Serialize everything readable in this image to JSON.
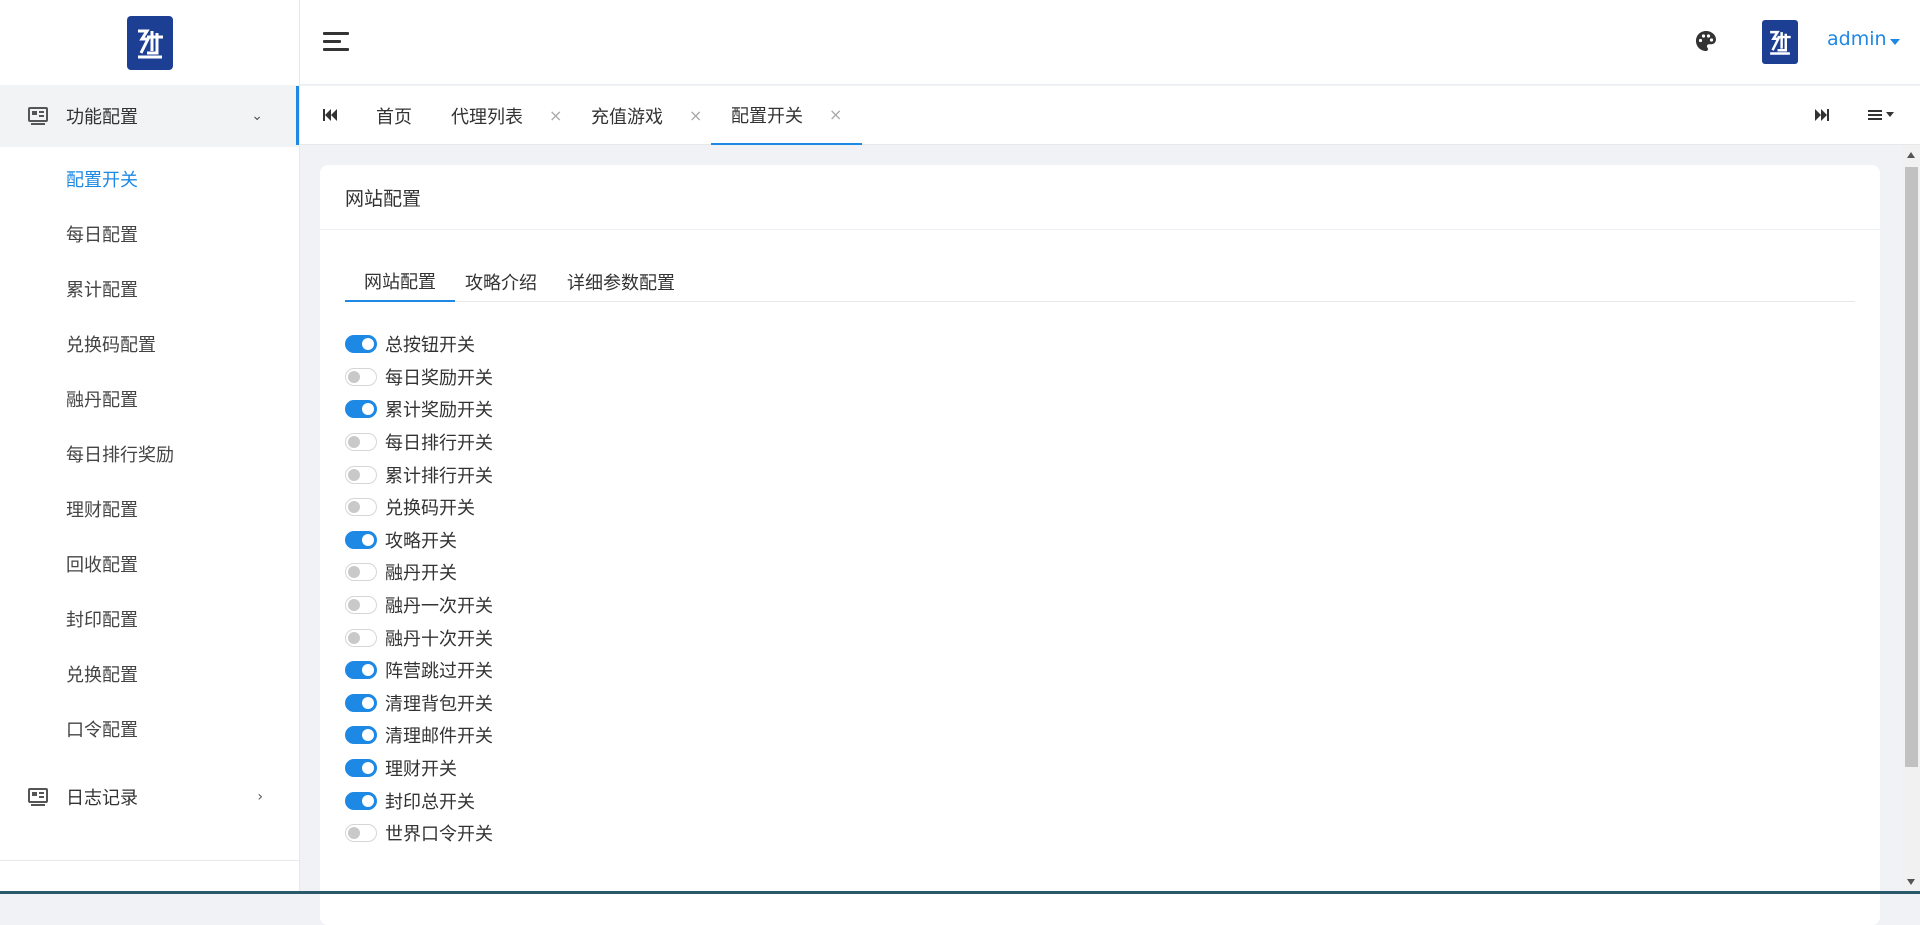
{
  "sidebar": {
    "groups": [
      {
        "label": "功能配置",
        "arrow": "⌄"
      },
      {
        "label": "日志记录",
        "arrow": "›"
      }
    ],
    "items": [
      {
        "label": "配置开关"
      },
      {
        "label": "每日配置"
      },
      {
        "label": "累计配置"
      },
      {
        "label": "兑换码配置"
      },
      {
        "label": "融丹配置"
      },
      {
        "label": "每日排行奖励"
      },
      {
        "label": "理财配置"
      },
      {
        "label": "回收配置"
      },
      {
        "label": "封印配置"
      },
      {
        "label": "兑换配置"
      },
      {
        "label": "口令配置"
      }
    ]
  },
  "header": {
    "user_name": "admin"
  },
  "tabs": [
    {
      "label": "首页",
      "close": ""
    },
    {
      "label": "代理列表",
      "close": "×"
    },
    {
      "label": "充值游戏",
      "close": "×"
    },
    {
      "label": "配置开关",
      "close": "×"
    }
  ],
  "card": {
    "title": "网站配置",
    "inner_tabs": [
      {
        "label": "网站配置"
      },
      {
        "label": "攻略介绍"
      },
      {
        "label": "详细参数配置"
      }
    ],
    "switches": [
      {
        "label": "总按钮开关",
        "on": true
      },
      {
        "label": "每日奖励开关",
        "on": false
      },
      {
        "label": "累计奖励开关",
        "on": true
      },
      {
        "label": "每日排行开关",
        "on": false
      },
      {
        "label": "累计排行开关",
        "on": false
      },
      {
        "label": "兑换码开关",
        "on": false
      },
      {
        "label": "攻略开关",
        "on": true
      },
      {
        "label": "融丹开关",
        "on": false
      },
      {
        "label": "融丹一次开关",
        "on": false
      },
      {
        "label": "融丹十次开关",
        "on": false
      },
      {
        "label": "阵营跳过开关",
        "on": true
      },
      {
        "label": "清理背包开关",
        "on": true
      },
      {
        "label": "清理邮件开关",
        "on": true
      },
      {
        "label": "理财开关",
        "on": true
      },
      {
        "label": "封印总开关",
        "on": true
      },
      {
        "label": "世界口令开关",
        "on": false
      }
    ]
  },
  "colors": {
    "accent": "#1e88e5",
    "logo": "#1d3f93"
  }
}
